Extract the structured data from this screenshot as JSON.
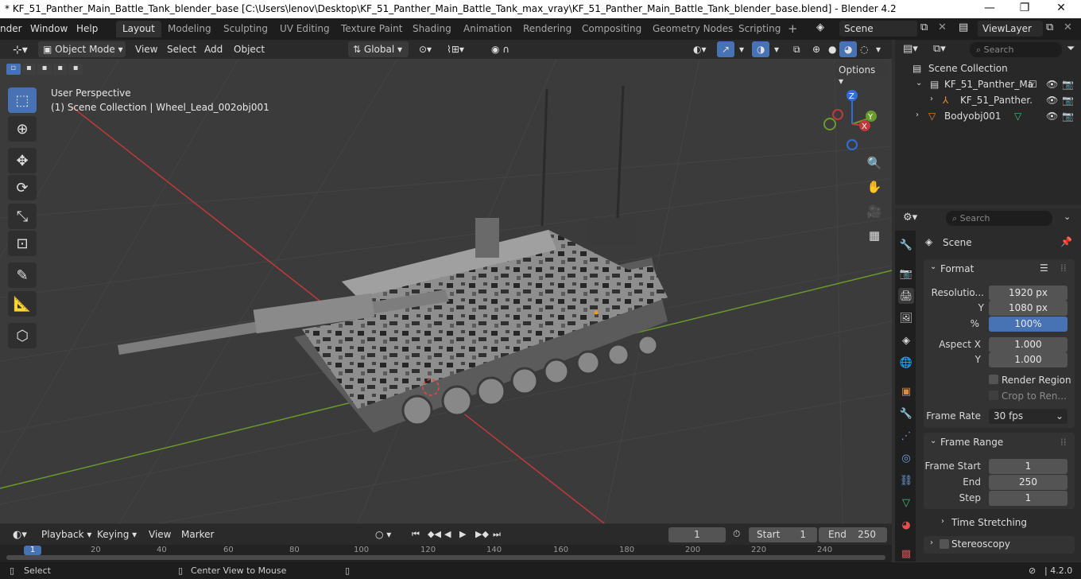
{
  "title_bar": {
    "text": "* KF_51_Panther_Main_Battle_Tank_blender_base [C:\\Users\\lenov\\Desktop\\KF_51_Panther_Main_Battle_Tank_max_vray\\KF_51_Panther_Main_Battle_Tank_blender_base.blend] - Blender 4.2",
    "minimize": "—",
    "maximize": "❐",
    "close": "✕"
  },
  "menu": {
    "render": "nder",
    "window": "Window",
    "help": "Help"
  },
  "workspaces": [
    "Layout",
    "Modeling",
    "Sculpting",
    "UV Editing",
    "Texture Paint",
    "Shading",
    "Animation",
    "Rendering",
    "Compositing",
    "Geometry Nodes",
    "Scripting"
  ],
  "scene_field": "Scene",
  "viewlayer_field": "ViewLayer",
  "viewport_header": {
    "mode": "Object Mode",
    "view": "View",
    "select": "Select",
    "add": "Add",
    "object": "Object",
    "orientation": "Global",
    "options": "Options"
  },
  "viewport": {
    "perspective": "User Perspective",
    "collection_info": "(1) Scene Collection | Wheel_Lead_002obj001",
    "gizmo": {
      "x": "X",
      "y": "Y",
      "z": "Z"
    }
  },
  "outliner": {
    "search_placeholder": "Search",
    "items": [
      {
        "label": "Scene Collection"
      },
      {
        "label": "KF_51_Panther_Ma"
      },
      {
        "label": "KF_51_Panther."
      },
      {
        "label": "Bodyobj001"
      }
    ]
  },
  "properties": {
    "search_placeholder": "Search",
    "context": "Scene",
    "format_panel": {
      "title": "Format",
      "resolution_label": "Resolutio...",
      "resolution_x": "1920 px",
      "y_label": "Y",
      "resolution_y": "1080 px",
      "percent_label": "%",
      "percent": "100%",
      "aspect_x_label": "Aspect X",
      "aspect_x": "1.000",
      "aspect_y_label": "Y",
      "aspect_y": "1.000",
      "render_region": "Render Region",
      "crop": "Crop to Ren...",
      "frame_rate_label": "Frame Rate",
      "frame_rate": "30 fps"
    },
    "frame_range_panel": {
      "title": "Frame Range",
      "start_label": "Frame Start",
      "start": "1",
      "end_label": "End",
      "end": "250",
      "step_label": "Step",
      "step": "1"
    },
    "time_stretching": "Time Stretching",
    "stereoscopy": "Stereoscopy"
  },
  "timeline": {
    "playback": "Playback",
    "keying": "Keying",
    "view": "View",
    "marker": "Marker",
    "current_frame": "1",
    "start_label": "Start",
    "start": "1",
    "end_label": "End",
    "end": "250",
    "ruler": [
      "1",
      "20",
      "40",
      "60",
      "80",
      "100",
      "120",
      "140",
      "160",
      "180",
      "200",
      "220",
      "240"
    ]
  },
  "status_bar": {
    "select": "Select",
    "center_view": "Center View to Mouse",
    "version": "4.2.0"
  },
  "colors": {
    "accent": "#4772b3",
    "x_axis": "#c0393b",
    "y_axis": "#6a9a2c",
    "z_axis": "#2e6fd6"
  }
}
